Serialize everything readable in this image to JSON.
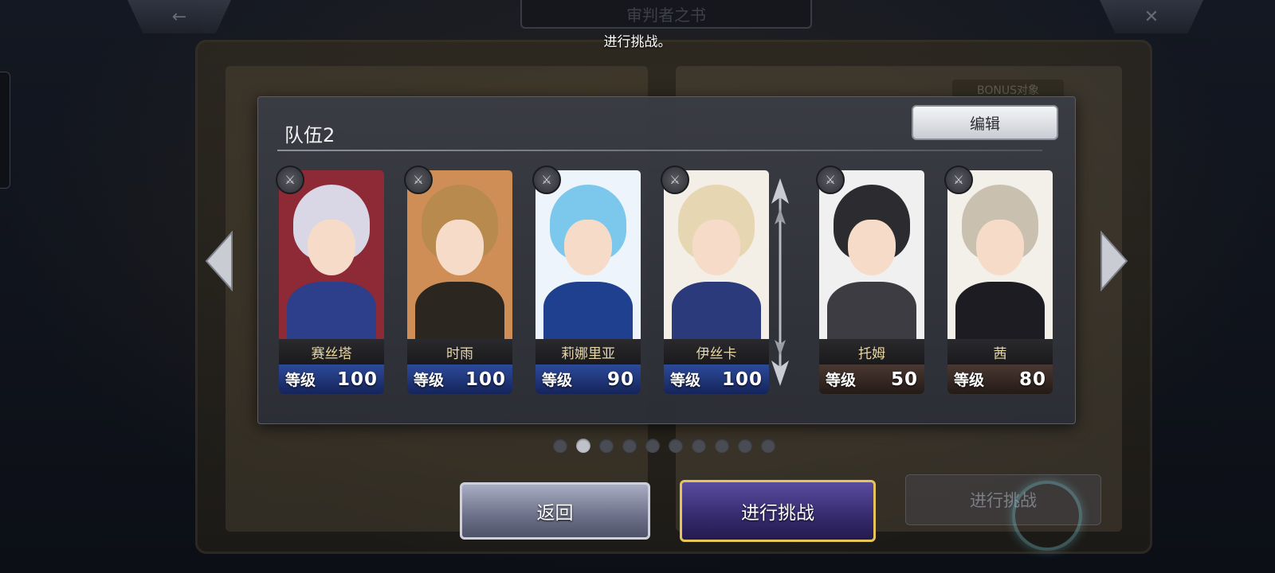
{
  "header": {
    "back_icon": "←",
    "close_icon": "✕",
    "book_title": "审判者之书",
    "toast": "进行挑战。",
    "bonus_label": "BONUS对象"
  },
  "team": {
    "title": "队伍2",
    "edit_label": "编辑",
    "members": [
      {
        "name": "赛丝塔",
        "level_label": "等级",
        "level": "100",
        "level_style": "blue",
        "hair": "#d9d6e6",
        "outfit": "#2d3e8a",
        "bg": "#8e2a36"
      },
      {
        "name": "时雨",
        "level_label": "等级",
        "level": "100",
        "level_style": "blue",
        "hair": "#b98a4e",
        "outfit": "#2b2620",
        "bg": "#cf8e56"
      },
      {
        "name": "莉娜里亚",
        "level_label": "等级",
        "level": "90",
        "level_style": "blue",
        "hair": "#7cc8ec",
        "outfit": "#1f3f8f",
        "bg": "#eef4fb"
      },
      {
        "name": "伊丝卡",
        "level_label": "等级",
        "level": "100",
        "level_style": "blue",
        "hair": "#e6d6b2",
        "outfit": "#2a3a7a",
        "bg": "#f3efe6"
      },
      {
        "name": "托姆",
        "level_label": "等级",
        "level": "50",
        "level_style": "dark",
        "hair": "#2c2c30",
        "outfit": "#3c3c42",
        "bg": "#f0f0f0"
      },
      {
        "name": "茜",
        "level_label": "等级",
        "level": "80",
        "level_style": "dark",
        "hair": "#c9c0b0",
        "outfit": "#1c1c22",
        "bg": "#f3f0ea"
      }
    ]
  },
  "pagination": {
    "total": 10,
    "active_index": 1
  },
  "buttons": {
    "back_label": "返回",
    "challenge_label": "进行挑战",
    "challenge_bg_label": "进行挑战"
  },
  "colors": {
    "accent_gold": "#e6c558",
    "challenge_purple": "#352b6e"
  }
}
